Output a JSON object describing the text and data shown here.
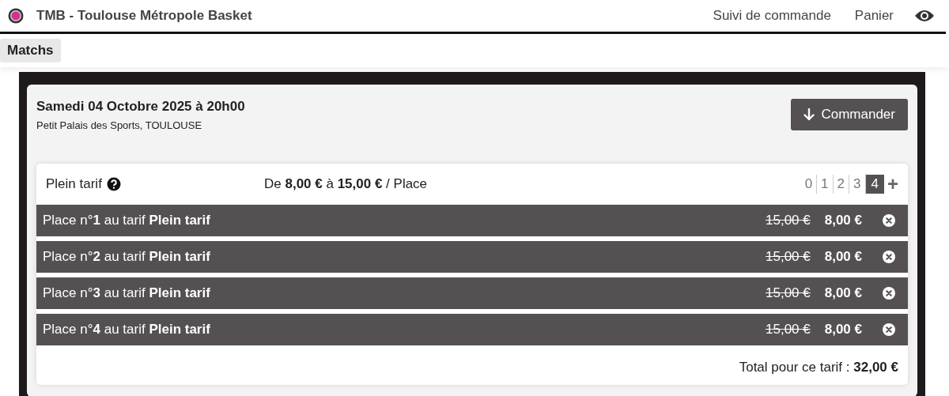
{
  "header": {
    "title": "TMB - Toulouse Métropole Basket",
    "nav": [
      "Suivi de commande",
      "Panier"
    ]
  },
  "tabs": [
    {
      "label": "Matchs",
      "selected": true
    }
  ],
  "event": {
    "title": "Samedi 04 Octobre 2025 à 20h00",
    "venue": "Petit Palais des Sports, TOULOUSE",
    "order_button": "Commander"
  },
  "tariff": {
    "name": "Plein tarif",
    "price_range": "De **8,00 €** à **15,00 €** / Place",
    "quantities": [
      {
        "label": "0",
        "selected": false
      },
      {
        "label": "1",
        "selected": false
      },
      {
        "label": "2",
        "selected": false
      },
      {
        "label": "3",
        "selected": false
      },
      {
        "label": "4",
        "selected": true
      }
    ],
    "more": "+",
    "places": [
      {
        "label": "Place n°**1** au tarif **Plein tarif**",
        "old_price": "15,00 €",
        "price": "8,00 €"
      },
      {
        "label": "Place n°**2** au tarif **Plein tarif**",
        "old_price": "15,00 €",
        "price": "8,00 €"
      },
      {
        "label": "Place n°**3** au tarif **Plein tarif**",
        "old_price": "15,00 €",
        "price": "8,00 €"
      },
      {
        "label": "Place n°**4** au tarif **Plein tarif**",
        "old_price": "15,00 €",
        "price": "8,00 €"
      }
    ],
    "total": "Total pour ce tarif : **32,00 €**"
  }
}
